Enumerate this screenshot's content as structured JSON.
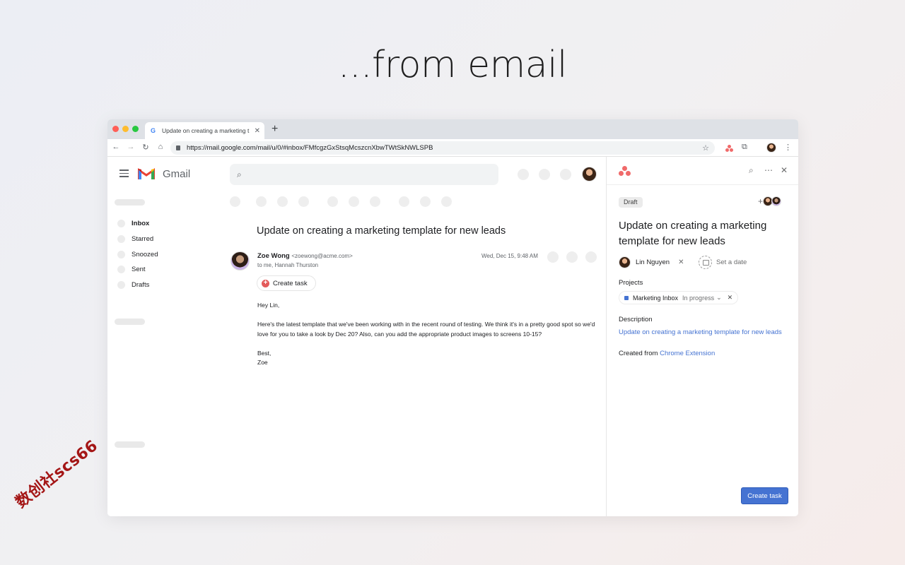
{
  "headline": "...from email",
  "watermark": "数创社scs66",
  "browser": {
    "tab_title": "Update on creating a marketing t",
    "tab_favicon": "G",
    "new_tab": "+",
    "url": "https://mail.google.com/mail/u/0/#inbox/FMfcgzGxStsqMcszcnXbwTWtSkNWLSPB"
  },
  "gmail": {
    "brand": "Gmail",
    "nav_items": [
      {
        "label": "Inbox",
        "active": true
      },
      {
        "label": "Starred",
        "active": false
      },
      {
        "label": "Snoozed",
        "active": false
      },
      {
        "label": "Sent",
        "active": false
      },
      {
        "label": "Drafts",
        "active": false
      }
    ],
    "subject": "Update on creating a marketing template for new leads",
    "sender_name": "Zoe Wong",
    "sender_email": "<zoewong@acme.com>",
    "recipients": "to me, Hannah Thurston",
    "date": "Wed, Dec 15, 9:48 AM",
    "create_task_label": "Create task",
    "body": {
      "greeting": "Hey Lin,",
      "paragraph": "Here's the latest template that we've been working with in the recent round of testing. We think it's in a pretty good spot so we'd love for you to take a look by Dec 20? Also, can you add the appropriate product images to screens 10-15?",
      "signoff": "Best,",
      "signature": "Zoe"
    }
  },
  "asana": {
    "status_badge": "Draft",
    "task_title": "Update on creating a marketing template for new leads",
    "assignee": "Lin Nguyen",
    "due_date_placeholder": "Set a date",
    "projects_label": "Projects",
    "project_name": "Marketing Inbox",
    "project_status": "In progress",
    "description_label": "Description",
    "description_link": "Update on creating a marketing template for new leads",
    "created_from_prefix": "Created from",
    "created_from_link": "Chrome Extension",
    "create_button": "Create task",
    "accent": "#4573d2",
    "brand_color": "#f06a6a"
  }
}
